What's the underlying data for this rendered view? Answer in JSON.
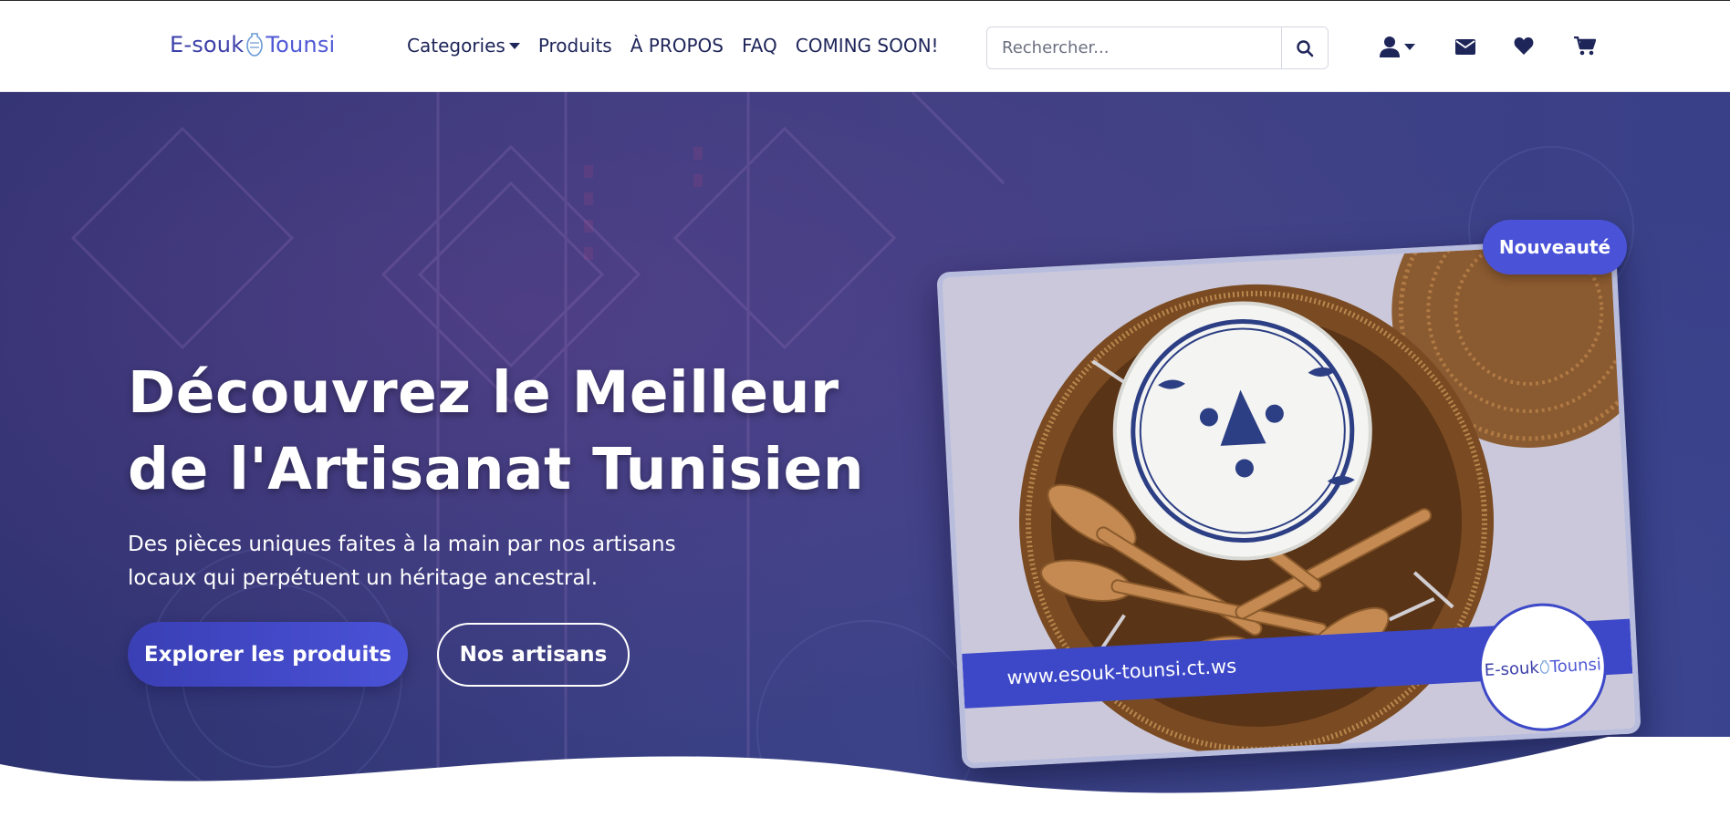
{
  "brand": {
    "part1": "E-souk",
    "part2": "Tounsi"
  },
  "nav": {
    "categories": "Categories",
    "produits": "Produits",
    "apropos": "À PROPOS",
    "faq": "FAQ",
    "coming_soon": "COMING SOON!"
  },
  "search": {
    "placeholder": "Rechercher...",
    "value": ""
  },
  "header_icons": [
    "user-icon",
    "envelope-icon",
    "heart-icon",
    "cart-icon"
  ],
  "hero": {
    "title_line1": "Découvrez le Meilleur",
    "title_line2": "de l'Artisanat Tunisien",
    "subtitle_line1": "Des pièces uniques faites à la main par nos artisans",
    "subtitle_line2": "locaux qui perpétuent un héritage ancestral.",
    "primary_button": "Explorer les produits",
    "secondary_button": "Nos artisans",
    "badge": "Nouveauté",
    "card_url": "www.esouk-tounsi.ct.ws",
    "card_logo_part1": "E-souk",
    "card_logo_part2": "Tounsi"
  },
  "colors": {
    "brand_blue": "#4a52d8",
    "nav_text": "#1e2559",
    "hero_bg": "#34397a",
    "url_strip": "#3d48c8"
  }
}
